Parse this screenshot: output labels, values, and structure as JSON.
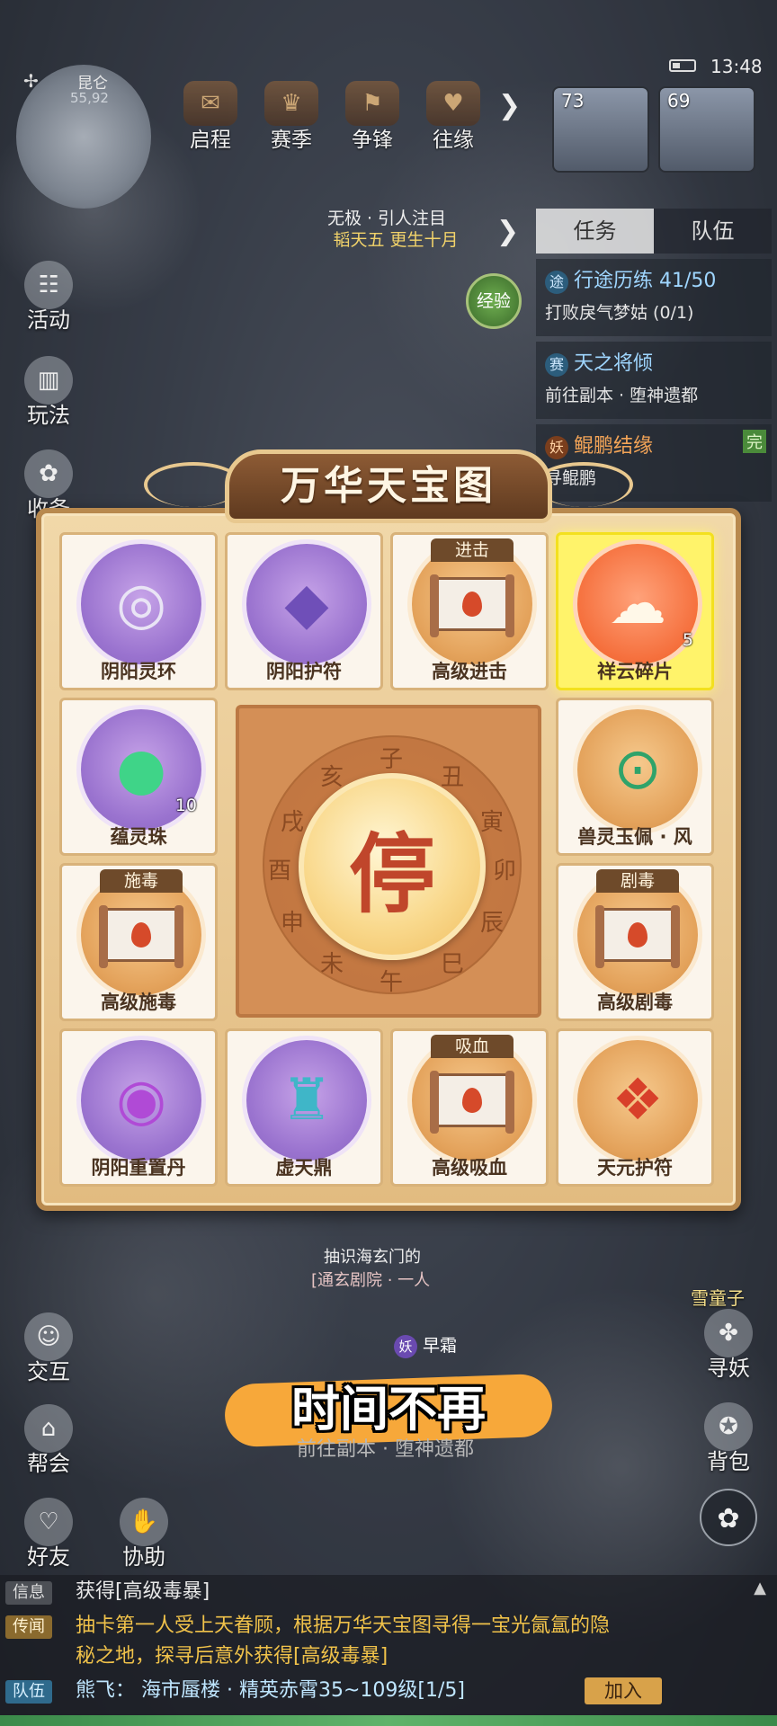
{
  "status": {
    "time": "13:48"
  },
  "minimap": {
    "location": "昆仑",
    "coords": "55,92"
  },
  "top_menu": [
    {
      "label": "启程",
      "icon": "scroll-icon"
    },
    {
      "label": "赛季",
      "icon": "trophy-icon"
    },
    {
      "label": "争锋",
      "icon": "flag-icon"
    },
    {
      "label": "往缘",
      "icon": "heart-icon"
    }
  ],
  "portraits": [
    {
      "level": "73"
    },
    {
      "level": "69"
    }
  ],
  "boss": {
    "title": "无极 · 引人注目",
    "name": "韬天五 更生十月"
  },
  "exp_label": "经验",
  "task_panel": {
    "tabs": [
      "任务",
      "队伍"
    ],
    "items": [
      {
        "tag": "途",
        "title": "行途历练 41/50",
        "desc": "打败戾气梦姑 (0/1)"
      },
      {
        "tag": "赛",
        "title": "天之将倾",
        "desc": "前往副本 · 堕神遗都"
      },
      {
        "tag": "妖",
        "title": "鲲鹏结缘",
        "desc": "寻鲲鹏",
        "done": "完"
      }
    ]
  },
  "side_menu_left": [
    "活动",
    "玩法",
    "收备",
    "交互",
    "帮会",
    "好友",
    "协助"
  ],
  "side_menu_right": [
    "寻妖",
    "背包"
  ],
  "modal": {
    "title": "万华天宝图",
    "center": {
      "button": "停",
      "zodiac": [
        "子",
        "丑",
        "寅",
        "卯",
        "辰",
        "巳",
        "午",
        "未",
        "申",
        "酉",
        "戌",
        "亥"
      ]
    },
    "items": {
      "r0c0": {
        "name": "阴阳灵环",
        "icon": "jade-ring-icon",
        "glyph": "◎"
      },
      "r0c1": {
        "name": "阴阳护符",
        "icon": "amulet-icon",
        "glyph": "◆"
      },
      "r0c2": {
        "name": "高级进击",
        "icon": "scroll-icon",
        "tag": "进击"
      },
      "r0c3": {
        "name": "祥云碎片",
        "icon": "cloud-puzzle-icon",
        "glyph": "☁",
        "qty": "5",
        "highlighted": true
      },
      "r1c0": {
        "name": "蕴灵珠",
        "icon": "green-orb-icon",
        "glyph": "●",
        "qty": "10"
      },
      "r1c3": {
        "name": "兽灵玉佩 · 风",
        "icon": "dragon-jade-icon",
        "glyph": "⊙"
      },
      "r2c0": {
        "name": "高级施毒",
        "icon": "scroll-icon",
        "tag": "施毒"
      },
      "r2c3": {
        "name": "高级剧毒",
        "icon": "scroll-icon",
        "tag": "剧毒"
      },
      "r3c0": {
        "name": "阴阳重置丹",
        "icon": "crystal-ball-icon",
        "glyph": "◉"
      },
      "r3c1": {
        "name": "虚天鼎",
        "icon": "cauldron-icon",
        "glyph": "♜"
      },
      "r3c2": {
        "name": "高级吸血",
        "icon": "scroll-icon",
        "tag": "吸血"
      },
      "r3c3": {
        "name": "天元护符",
        "icon": "red-amulet-icon",
        "glyph": "❖"
      }
    }
  },
  "scene": {
    "text1": "抽识海玄门的",
    "text2": "[通玄剧院 · 一人",
    "npc_tag": "妖",
    "npc_name": "早霜",
    "right_npc": "雪童子",
    "quest_hint": "前往副本 · 堕神遗都"
  },
  "subtitle": "时间不再",
  "chat": {
    "rows": [
      {
        "channel": "信息",
        "text": "获得[高级毒暴]"
      },
      {
        "channel": "传闻",
        "text": "抽卡第一人受上天眷顾，根据万华天宝图寻得一宝光氤氲的隐"
      },
      {
        "channel": "",
        "text": "秘之地，探寻后意外获得[高级毒暴]"
      },
      {
        "channel": "队伍",
        "text": "熊飞：  海市蜃楼 · 精英赤霄35~109级[1/5]"
      }
    ],
    "join": "加入"
  }
}
